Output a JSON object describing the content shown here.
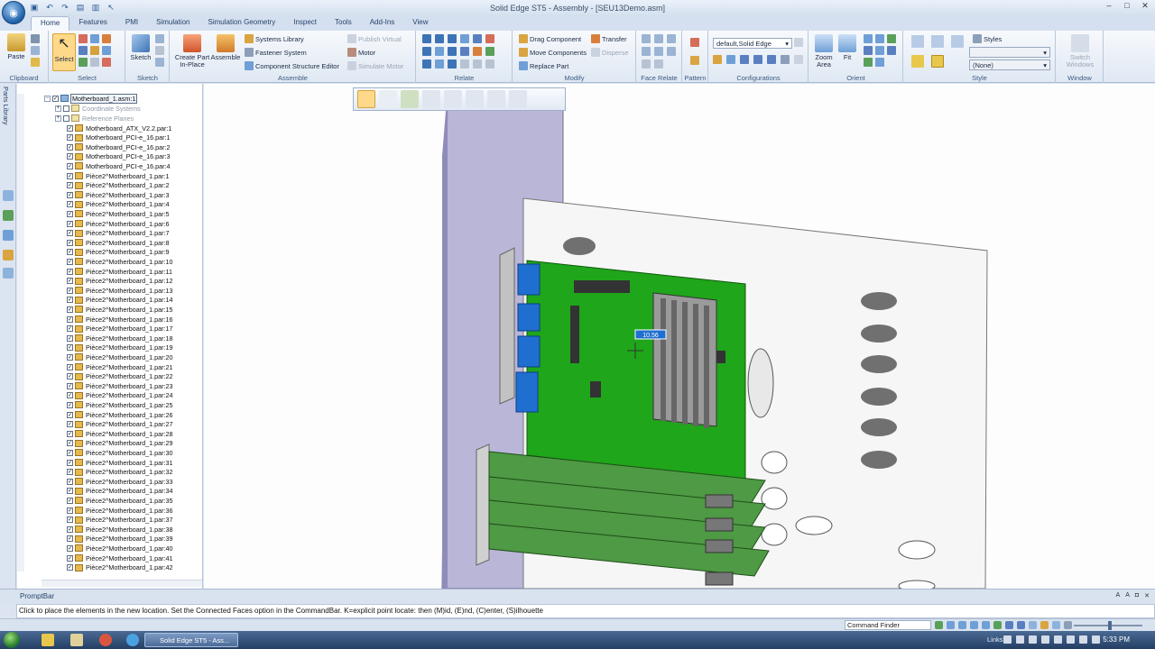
{
  "window": {
    "title": "Solid Edge ST5 - Assembly - [SEU13Demo.asm]",
    "controls": [
      "–",
      "□",
      "✕"
    ]
  },
  "tabs": [
    "Home",
    "Features",
    "PMI",
    "Simulation",
    "Simulation Geometry",
    "Inspect",
    "Tools",
    "Add-Ins",
    "View"
  ],
  "active_tab": "Home",
  "ribbon": {
    "clipboard": {
      "name": "Clipboard",
      "paste": "Paste"
    },
    "select": {
      "name": "Select",
      "select": "Select"
    },
    "sketch": {
      "name": "Sketch",
      "sketch": "Sketch"
    },
    "assemble": {
      "name": "Assemble",
      "create_part_in_place": "Create Part In-Place",
      "assemble": "Assemble",
      "systems_library": "Systems Library",
      "fastener_system": "Fastener System",
      "component_structure_editor": "Component Structure Editor",
      "publish_virtual": "Publish Virtual",
      "motor": "Motor",
      "simulate_motor": "Simulate Motor"
    },
    "relate": {
      "name": "Relate"
    },
    "modify": {
      "name": "Modify",
      "drag_component": "Drag Component",
      "move_components": "Move Components",
      "replace_part": "Replace Part",
      "transfer": "Transfer",
      "disperse": "Disperse"
    },
    "face_relate": {
      "name": "Face Relate"
    },
    "pattern": {
      "name": "Pattern"
    },
    "configurations": {
      "name": "Configurations",
      "combo_value": "default,Solid Edge"
    },
    "orient": {
      "name": "Orient",
      "zoom_area": "Zoom Area",
      "fit": "Fit"
    },
    "style": {
      "name": "Style",
      "styles": "Styles",
      "combo_value": "(None)"
    },
    "window_group": {
      "name": "Window",
      "switch_windows": "Switch Windows"
    }
  },
  "sidebar": {
    "parts_library": "Parts Library"
  },
  "tree": {
    "root": "Motherboard_1.asm:1",
    "coordinate_systems": "Coordinate Systems",
    "reference_planes": "Reference Planes",
    "parts": [
      "Motherboard_ATX_V2.2.par:1",
      "Motherboard_PCI-e_16.par:1",
      "Motherboard_PCI-e_16.par:2",
      "Motherboard_PCI-e_16.par:3",
      "Motherboard_PCI-e_16.par:4",
      "Pièce2^Motherboard_1.par:1",
      "Pièce2^Motherboard_1.par:2",
      "Pièce2^Motherboard_1.par:3",
      "Pièce2^Motherboard_1.par:4",
      "Pièce2^Motherboard_1.par:5",
      "Pièce2^Motherboard_1.par:6",
      "Pièce2^Motherboard_1.par:7",
      "Pièce2^Motherboard_1.par:8",
      "Pièce2^Motherboard_1.par:9",
      "Pièce2^Motherboard_1.par:10",
      "Pièce2^Motherboard_1.par:11",
      "Pièce2^Motherboard_1.par:12",
      "Pièce2^Motherboard_1.par:13",
      "Pièce2^Motherboard_1.par:14",
      "Pièce2^Motherboard_1.par:15",
      "Pièce2^Motherboard_1.par:16",
      "Pièce2^Motherboard_1.par:17",
      "Pièce2^Motherboard_1.par:18",
      "Pièce2^Motherboard_1.par:19",
      "Pièce2^Motherboard_1.par:20",
      "Pièce2^Motherboard_1.par:21",
      "Pièce2^Motherboard_1.par:22",
      "Pièce2^Motherboard_1.par:23",
      "Pièce2^Motherboard_1.par:24",
      "Pièce2^Motherboard_1.par:25",
      "Pièce2^Motherboard_1.par:26",
      "Pièce2^Motherboard_1.par:27",
      "Pièce2^Motherboard_1.par:28",
      "Pièce2^Motherboard_1.par:29",
      "Pièce2^Motherboard_1.par:30",
      "Pièce2^Motherboard_1.par:31",
      "Pièce2^Motherboard_1.par:32",
      "Pièce2^Motherboard_1.par:33",
      "Pièce2^Motherboard_1.par:34",
      "Pièce2^Motherboard_1.par:35",
      "Pièce2^Motherboard_1.par:36",
      "Pièce2^Motherboard_1.par:37",
      "Pièce2^Motherboard_1.par:38",
      "Pièce2^Motherboard_1.par:39",
      "Pièce2^Motherboard_1.par:40",
      "Pièce2^Motherboard_1.par:41",
      "Pièce2^Motherboard_1.par:42"
    ]
  },
  "viewport": {
    "dimension_value": "10.56"
  },
  "prompt": {
    "title": "PromptBar",
    "text": "Click to place the elements in the new location.  Set the Connected Faces option in the CommandBar.  K=explicit point locate: then (M)id, (E)nd, (C)enter, (S)ilhouette"
  },
  "status": {
    "command_finder": "Command Finder"
  },
  "taskbar": {
    "task_label": "Solid Edge ST5 - Ass...",
    "links": "Links",
    "clock": "5:33 PM"
  },
  "colors": {
    "board_green": "#1fa61a",
    "card_green": "#4f9a45",
    "blue_connector": "#1f6fd0",
    "ribbon_bg": "#dfe8f3",
    "highlight": "#ffd98a"
  }
}
